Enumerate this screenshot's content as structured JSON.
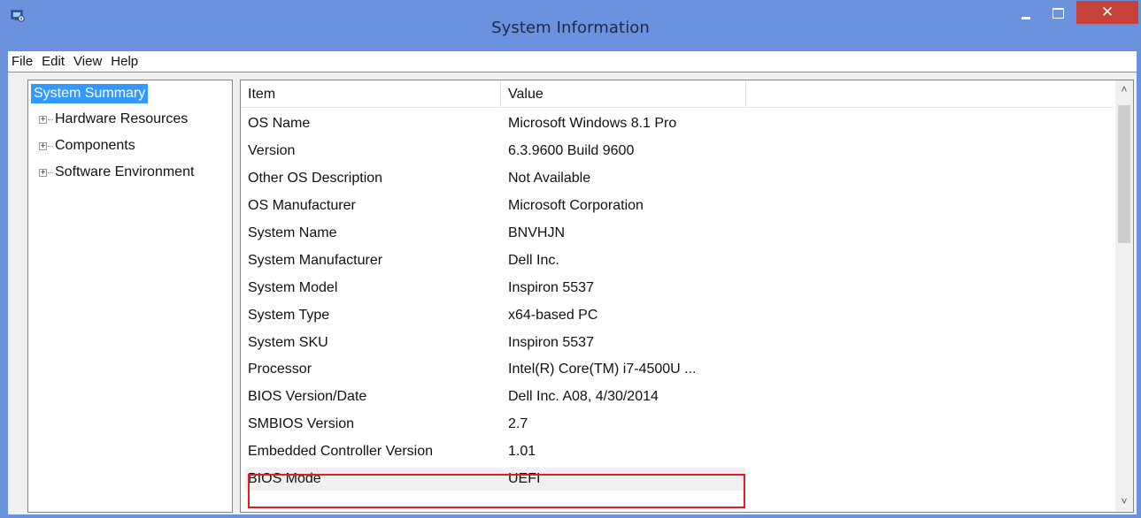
{
  "window": {
    "title": "System Information",
    "close_glyph": "✕",
    "colors": {
      "titlebar": "#6b92de",
      "close": "#c6413a",
      "selection": "#3399ff",
      "annotation": "#e02020"
    }
  },
  "menu": [
    "File",
    "Edit",
    "View",
    "Help"
  ],
  "tree": {
    "root": "System Summary",
    "nodes": [
      {
        "label": "Hardware Resources",
        "expander": "+"
      },
      {
        "label": "Components",
        "expander": "+"
      },
      {
        "label": "Software Environment",
        "expander": "+"
      }
    ]
  },
  "list": {
    "columns": [
      "Item",
      "Value"
    ],
    "rows": [
      [
        "OS Name",
        "Microsoft Windows 8.1 Pro"
      ],
      [
        "Version",
        "6.3.9600 Build 9600"
      ],
      [
        "Other OS Description",
        "Not Available"
      ],
      [
        "OS Manufacturer",
        "Microsoft Corporation"
      ],
      [
        "System Name",
        "BNVHJN"
      ],
      [
        "System Manufacturer",
        "Dell Inc."
      ],
      [
        "System Model",
        "Inspiron 5537"
      ],
      [
        "System Type",
        "x64-based PC"
      ],
      [
        "System SKU",
        "Inspiron 5537"
      ],
      [
        "Processor",
        "Intel(R) Core(TM) i7-4500U ..."
      ],
      [
        "BIOS Version/Date",
        "Dell Inc. A08, 4/30/2014"
      ],
      [
        "SMBIOS Version",
        "2.7"
      ],
      [
        "Embedded Controller Version",
        "1.01"
      ],
      [
        "BIOS Mode",
        "UEFI"
      ]
    ],
    "highlighted_row": "BIOS Mode",
    "scroll_up_glyph": "˄",
    "scroll_down_glyph": "˅"
  }
}
